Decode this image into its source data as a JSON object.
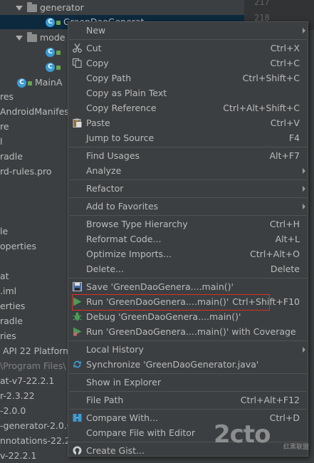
{
  "tree": {
    "items": [
      {
        "label": "generator",
        "kind": "folder"
      },
      {
        "label": "GreenDaoGenerat",
        "kind": "class"
      },
      {
        "label": "mode",
        "kind": "folder"
      },
      {
        "label": "",
        "kind": "class"
      },
      {
        "label": "",
        "kind": "class"
      },
      {
        "label": "MainA",
        "kind": "class"
      },
      {
        "label": "res"
      },
      {
        "label": "AndroidManifest"
      },
      {
        "label": "re"
      },
      {
        "label": "l"
      },
      {
        "label": "radle"
      },
      {
        "label": "rd-rules.pro"
      },
      {
        "label": "le"
      },
      {
        "label": "operties"
      },
      {
        "label": "at"
      },
      {
        "label": ".iml"
      },
      {
        "label": "erties"
      },
      {
        "label": "radle"
      },
      {
        "label": "ries"
      },
      {
        "label": "API 22 Platform"
      },
      {
        "label": "\\Program Files\\"
      },
      {
        "label": "at-v7-22.2.1"
      },
      {
        "label": "r-2.3.22"
      },
      {
        "label": "-2.0.0"
      },
      {
        "label": "-generator-2.0.0"
      },
      {
        "label": "nnotations-22.2.1"
      },
      {
        "label": "v-22.2.1"
      }
    ]
  },
  "gutter": {
    "line1": "217",
    "line2": "218"
  },
  "menu": {
    "items": [
      {
        "label": "New",
        "submenu": true
      },
      {
        "label": "Cut",
        "shortcut": "Ctrl+X",
        "icon": "scissors-icon"
      },
      {
        "label": "Copy",
        "shortcut": "Ctrl+C",
        "icon": "copy-icon"
      },
      {
        "label": "Copy Path",
        "shortcut": "Ctrl+Shift+C"
      },
      {
        "label": "Copy as Plain Text"
      },
      {
        "label": "Copy Reference",
        "shortcut": "Ctrl+Alt+Shift+C"
      },
      {
        "label": "Paste",
        "shortcut": "Ctrl+V",
        "icon": "paste-icon"
      },
      {
        "label": "Jump to Source",
        "shortcut": "F4"
      },
      {
        "label": "Find Usages",
        "shortcut": "Alt+F7"
      },
      {
        "label": "Analyze",
        "submenu": true
      },
      {
        "label": "Refactor",
        "submenu": true
      },
      {
        "label": "Add to Favorites",
        "submenu": true
      },
      {
        "label": "Browse Type Hierarchy",
        "shortcut": "Ctrl+H"
      },
      {
        "label": "Reformat Code...",
        "shortcut": "Alt+L"
      },
      {
        "label": "Optimize Imports...",
        "shortcut": "Ctrl+Alt+O"
      },
      {
        "label": "Delete...",
        "shortcut": "Delete"
      },
      {
        "label": "Save 'GreenDaoGenera....main()'",
        "icon": "save-icon"
      },
      {
        "label": "Run 'GreenDaoGenera....main()'",
        "shortcut": "Ctrl+Shift+F10",
        "icon": "run-icon"
      },
      {
        "label": "Debug 'GreenDaoGenera....main()'",
        "icon": "debug-icon"
      },
      {
        "label": "Run 'GreenDaoGenera....main()' with Coverage",
        "icon": "coverage-icon"
      },
      {
        "label": "Local History",
        "submenu": true
      },
      {
        "label": "Synchronize 'GreenDaoGenerator.java'",
        "icon": "sync-icon"
      },
      {
        "label": "Show in Explorer"
      },
      {
        "label": "File Path",
        "shortcut": "Ctrl+Alt+F12"
      },
      {
        "label": "Compare With...",
        "shortcut": "Ctrl+D",
        "icon": "compare-icon"
      },
      {
        "label": "Compare File with Editor"
      },
      {
        "label": "Create Gist...",
        "icon": "github-icon"
      }
    ]
  },
  "watermark": {
    "main": "2cto",
    "sub": "红黑联盟"
  },
  "colors": {
    "run_icon": "#499c54",
    "highlight_border": "#d93025",
    "selection": "#0d293e"
  }
}
